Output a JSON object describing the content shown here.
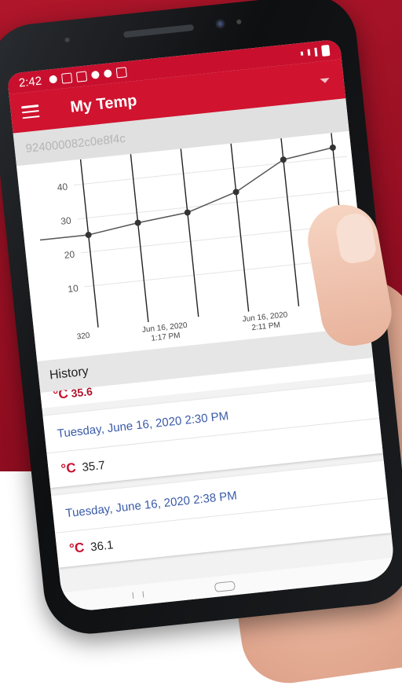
{
  "status_bar": {
    "time": "2:42"
  },
  "app_bar": {
    "title": "My Temp"
  },
  "device": {
    "id": "924000082c0e8f4c"
  },
  "chart_data": {
    "type": "line",
    "series": [
      {
        "values": [
          25,
          27,
          28.5,
          33,
          41,
          43
        ]
      }
    ],
    "y_ticks": [
      "40",
      "30",
      "20",
      "10"
    ],
    "x_tick_labels": [
      {
        "line1": "320",
        "line2": ""
      },
      {
        "line1": "Jun 16, 2020",
        "line2": "1:17 PM"
      },
      {
        "line1": "Jun 16, 2020",
        "line2": "2:11 PM"
      }
    ],
    "ylim": [
      0,
      45
    ],
    "grid": true
  },
  "history": {
    "title": "History",
    "partial_top": "35.6",
    "entries": [
      {
        "date": "Tuesday, June 16, 2020 2:30 PM",
        "unit": "°C",
        "value": "35.7"
      },
      {
        "date": "Tuesday, June 16, 2020 2:38 PM",
        "unit": "°C",
        "value": "36.1"
      }
    ]
  },
  "colors": {
    "brand_red": "#c8102e",
    "date_blue": "#3a5ba8"
  }
}
